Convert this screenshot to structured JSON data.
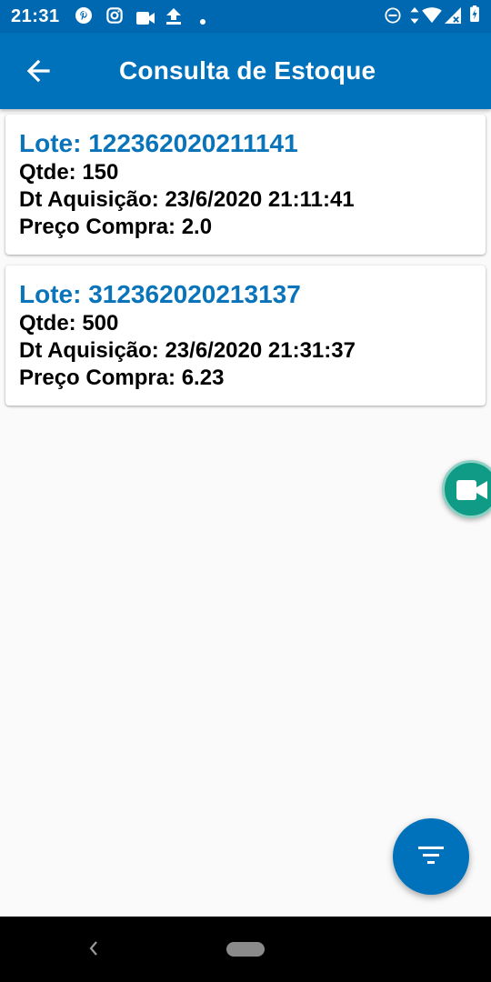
{
  "status_bar": {
    "time": "21:31",
    "left_icons": [
      "pinterest-icon",
      "instagram-icon",
      "video-icon",
      "upload-icon",
      "dot-icon"
    ],
    "right_icons": [
      "do-not-disturb-icon",
      "data-arrows-icon",
      "wifi-icon",
      "signal-icon",
      "battery-icon"
    ]
  },
  "app_bar": {
    "title": "Consulta de Estoque",
    "back_icon": "arrow-left-icon"
  },
  "lots": [
    {
      "lote": "Lote: 122362020211141",
      "qtde": "Qtde: 150",
      "dt_aquisicao": "Dt Aquisição: 23/6/2020 21:11:41",
      "preco_compra": "Preço Compra: 2.0"
    },
    {
      "lote": "Lote: 312362020213137",
      "qtde": "Qtde: 500",
      "dt_aquisicao": "Dt Aquisição: 23/6/2020 21:31:37",
      "preco_compra": "Preço Compra: 6.23"
    }
  ],
  "floating_camera": {
    "icon": "video-camera-icon"
  },
  "fab": {
    "icon": "filter-icon"
  },
  "colors": {
    "status_bar": "#0068b0",
    "app_bar": "#0072bb",
    "lote_text": "#0a74ba",
    "background": "#fafafa",
    "camera_button": "#0f9b86"
  }
}
